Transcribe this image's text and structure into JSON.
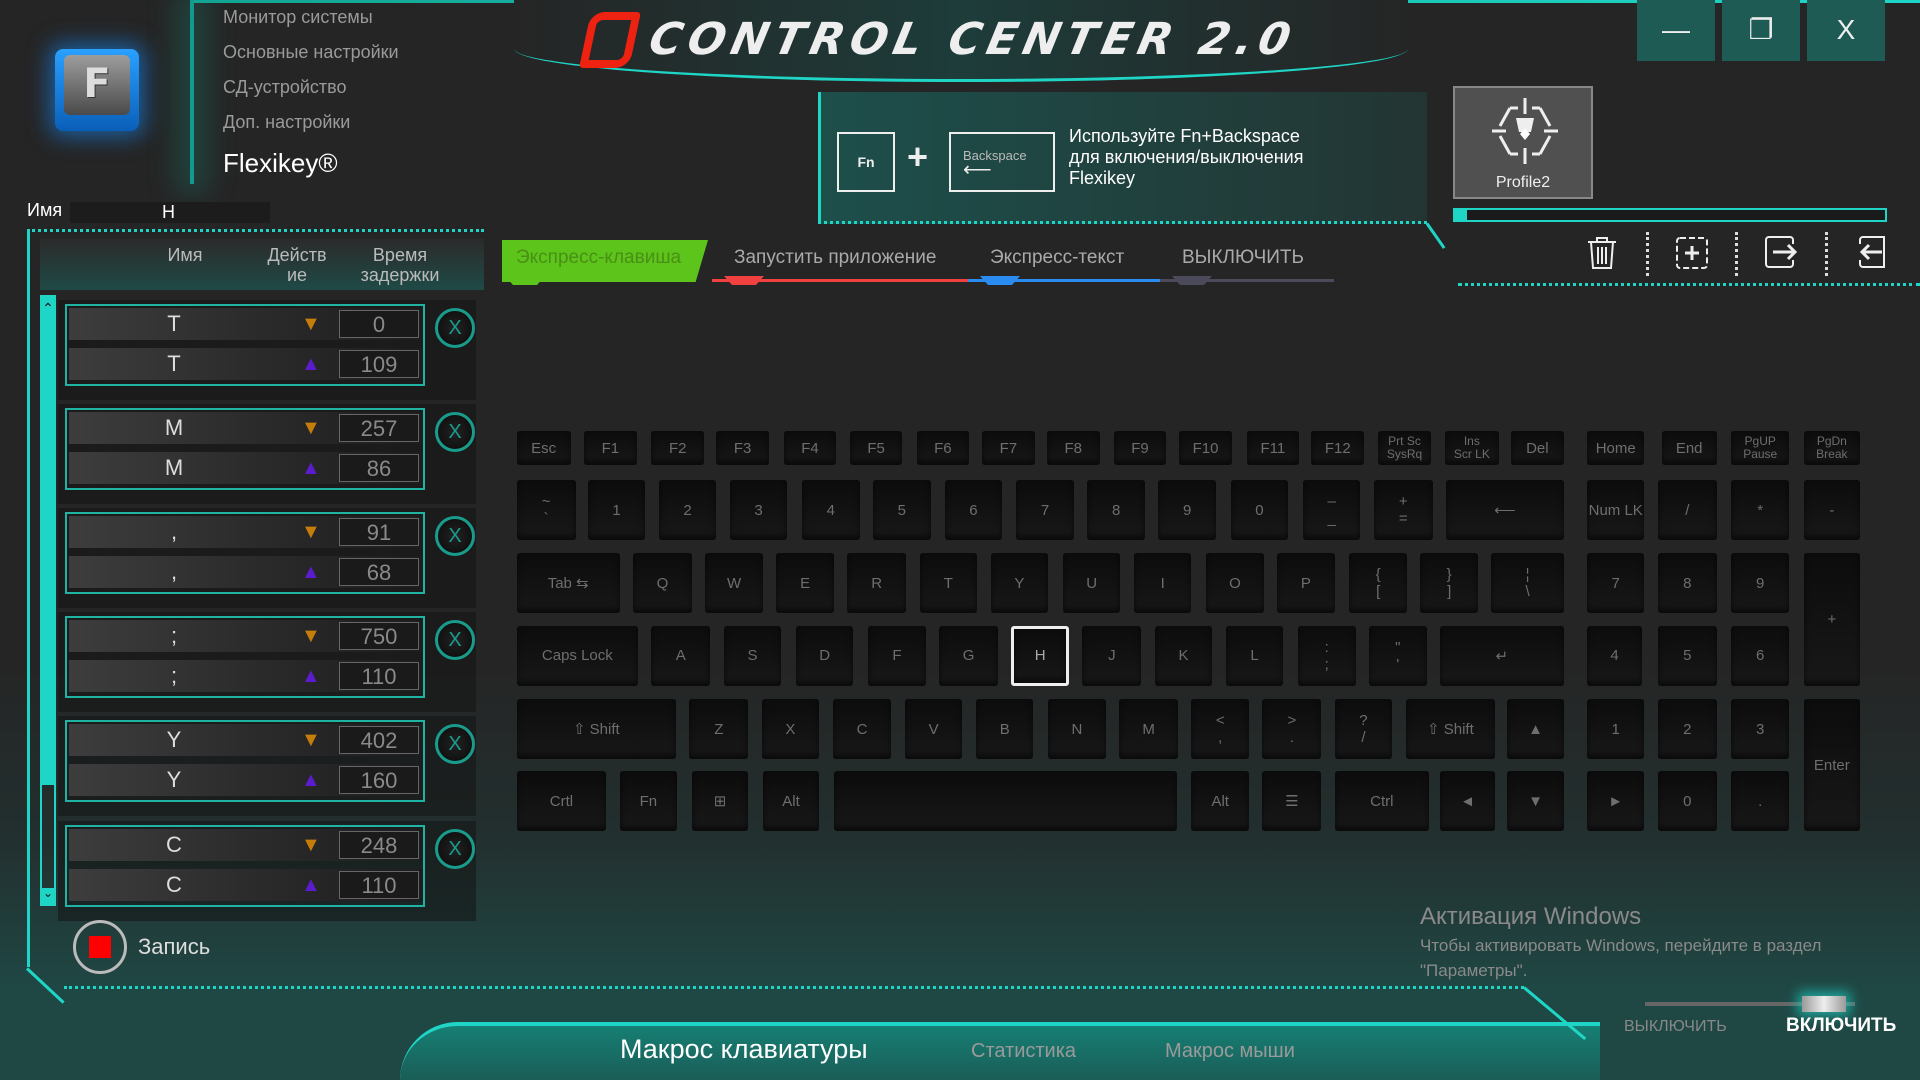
{
  "nav": {
    "items": [
      "Монитор системы",
      "Основные настройки",
      "СД-устройство",
      "Доп. настройки"
    ],
    "active": "Flexikey®"
  },
  "logo": {
    "letter": "F"
  },
  "header": {
    "title": "CONTROL CENTER 2.0"
  },
  "window": {
    "minimize": "—",
    "restore": "❐",
    "close": "X"
  },
  "info": {
    "fn_key": "Fn",
    "plus": "+",
    "backspace_key": "Backspace",
    "text_lines": [
      "Используйте Fn+Backspace",
      "для включения/выключения",
      "Flexikey"
    ]
  },
  "profile": {
    "name": "Profile2"
  },
  "tabs": [
    {
      "label": "Экспресс-клавиша",
      "color": "#5cc41a",
      "active": true
    },
    {
      "label": "Запустить приложение",
      "color": "#f04040"
    },
    {
      "label": "Экспресс-текст",
      "color": "#2a8cf0"
    },
    {
      "label": "ВЫКЛЮЧИТЬ",
      "color": "#4a4a5a"
    }
  ],
  "toolbar": {
    "icons": [
      "trash-icon",
      "add-icon",
      "export-icon",
      "import-icon"
    ]
  },
  "name_field": {
    "label": "Имя",
    "value": "H"
  },
  "macro_list": {
    "headers": [
      "Имя",
      "Действ ие",
      "Время задержки"
    ],
    "groups": [
      {
        "key": "T",
        "down": "0",
        "up": "109"
      },
      {
        "key": "M",
        "down": "257",
        "up": "86"
      },
      {
        "key": ",",
        "down": "91",
        "up": "68"
      },
      {
        "key": ";",
        "down": "750",
        "up": "110"
      },
      {
        "key": "Y",
        "down": "402",
        "up": "160"
      },
      {
        "key": "C",
        "down": "248",
        "up": "110"
      }
    ],
    "down_arrow": "▼",
    "up_arrow": "▲",
    "down_color": "#c47d0a",
    "up_color": "#5a1ccc",
    "delete": "X"
  },
  "record": {
    "label": "Запись"
  },
  "keyboard": {
    "selected": "H",
    "rows": [
      [
        "Esc",
        "F1",
        "F2",
        "F3",
        "F4",
        "F5",
        "F6",
        "F7",
        "F8",
        "F9",
        "F10",
        "F11",
        "F12",
        "Prt Sc|SysRq",
        "Ins|Scr LK",
        "Del",
        "Home",
        "End",
        "PgUP|Pause",
        "PgDn|Break"
      ],
      [
        "~|`",
        "1",
        "2",
        "3",
        "4",
        "5",
        "6",
        "7",
        "8",
        "9",
        "0",
        "–|_",
        "+|=",
        "⟵",
        "Num LK",
        "/",
        "*",
        "-"
      ],
      [
        "Tab ⇆",
        "Q",
        "W",
        "E",
        "R",
        "T",
        "Y",
        "U",
        "I",
        "O",
        "P",
        "{|[",
        "}|]",
        "¦|\\",
        "7",
        "8",
        "9",
        "+"
      ],
      [
        "Caps Lock",
        "A",
        "S",
        "D",
        "F",
        "G",
        "H",
        "J",
        "K",
        "L",
        ":|;",
        "\"|'",
        "↵",
        "4",
        "5",
        "6"
      ],
      [
        "⇧      Shift",
        "Z",
        "X",
        "C",
        "V",
        "B",
        "N",
        "M",
        "<|,",
        ">|.",
        "?|/",
        "⇧ Shift",
        "▲",
        "1",
        "2",
        "3",
        "Enter"
      ],
      [
        "Crtl",
        "Fn",
        "⊞",
        "Alt",
        "",
        "Alt",
        "☰",
        "Ctrl",
        "◄",
        "▼",
        "►",
        "0",
        "."
      ]
    ]
  },
  "watermark": {
    "title": "Активация Windows",
    "line1": "Чтобы активировать Windows, перейдите в раздел",
    "line2": "\"Параметры\"."
  },
  "bottom_tabs": [
    "Макрос клавиатуры",
    "Статистика",
    "Макрос мыши"
  ],
  "toggle": {
    "off": "ВЫКЛЮЧИТЬ",
    "on": "ВКЛЮЧИТЬ",
    "state": "on"
  }
}
